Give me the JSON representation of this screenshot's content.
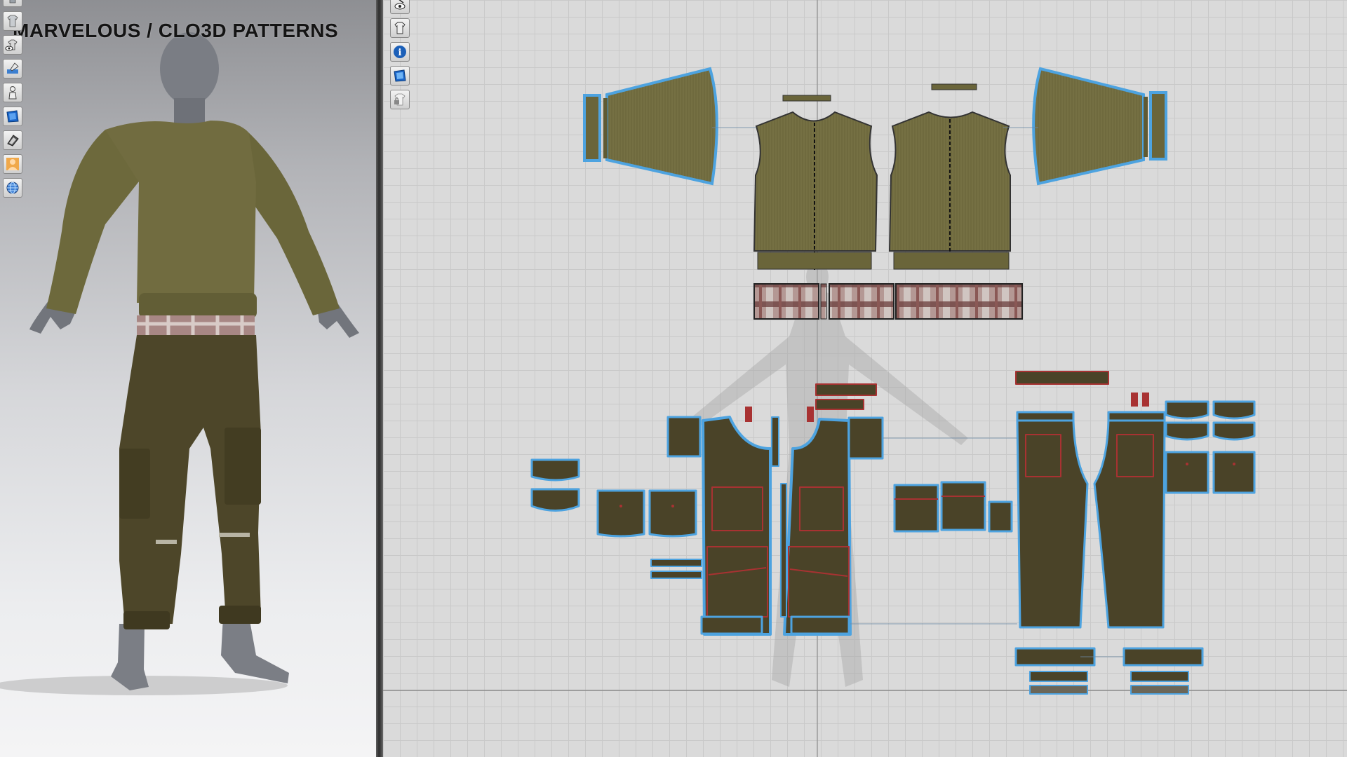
{
  "overlay": {
    "title": "MARVELOUS / CLO3D PATTERNS"
  },
  "viewport_3d": {
    "toolbar": [
      {
        "icon": "garment-view-icon"
      },
      {
        "icon": "garment-view-icon"
      },
      {
        "icon": "show-avatar-icon"
      },
      {
        "icon": "texture-brush-icon"
      },
      {
        "icon": "avatar-toggle-icon"
      },
      {
        "icon": "fabric-display-icon"
      },
      {
        "icon": "render-mode-icon"
      },
      {
        "icon": "avatar-skin-icon"
      },
      {
        "icon": "environment-globe-icon"
      }
    ]
  },
  "viewport_2d": {
    "toolbar": [
      {
        "icon": "pointer-eye-icon"
      },
      {
        "icon": "show-garment-icon"
      },
      {
        "icon": "info-icon"
      },
      {
        "icon": "fabric-texture-icon"
      },
      {
        "icon": "lock-icon"
      }
    ]
  },
  "colors": {
    "sweater": "#6f6a3e",
    "pants": "#4a4328",
    "seam_outline": "#4da3e0",
    "internal_line": "#a83232",
    "plaid_light": "#c9c2bb",
    "plaid_dark": "#7a4a48",
    "avatar_skin": "#777a80"
  }
}
